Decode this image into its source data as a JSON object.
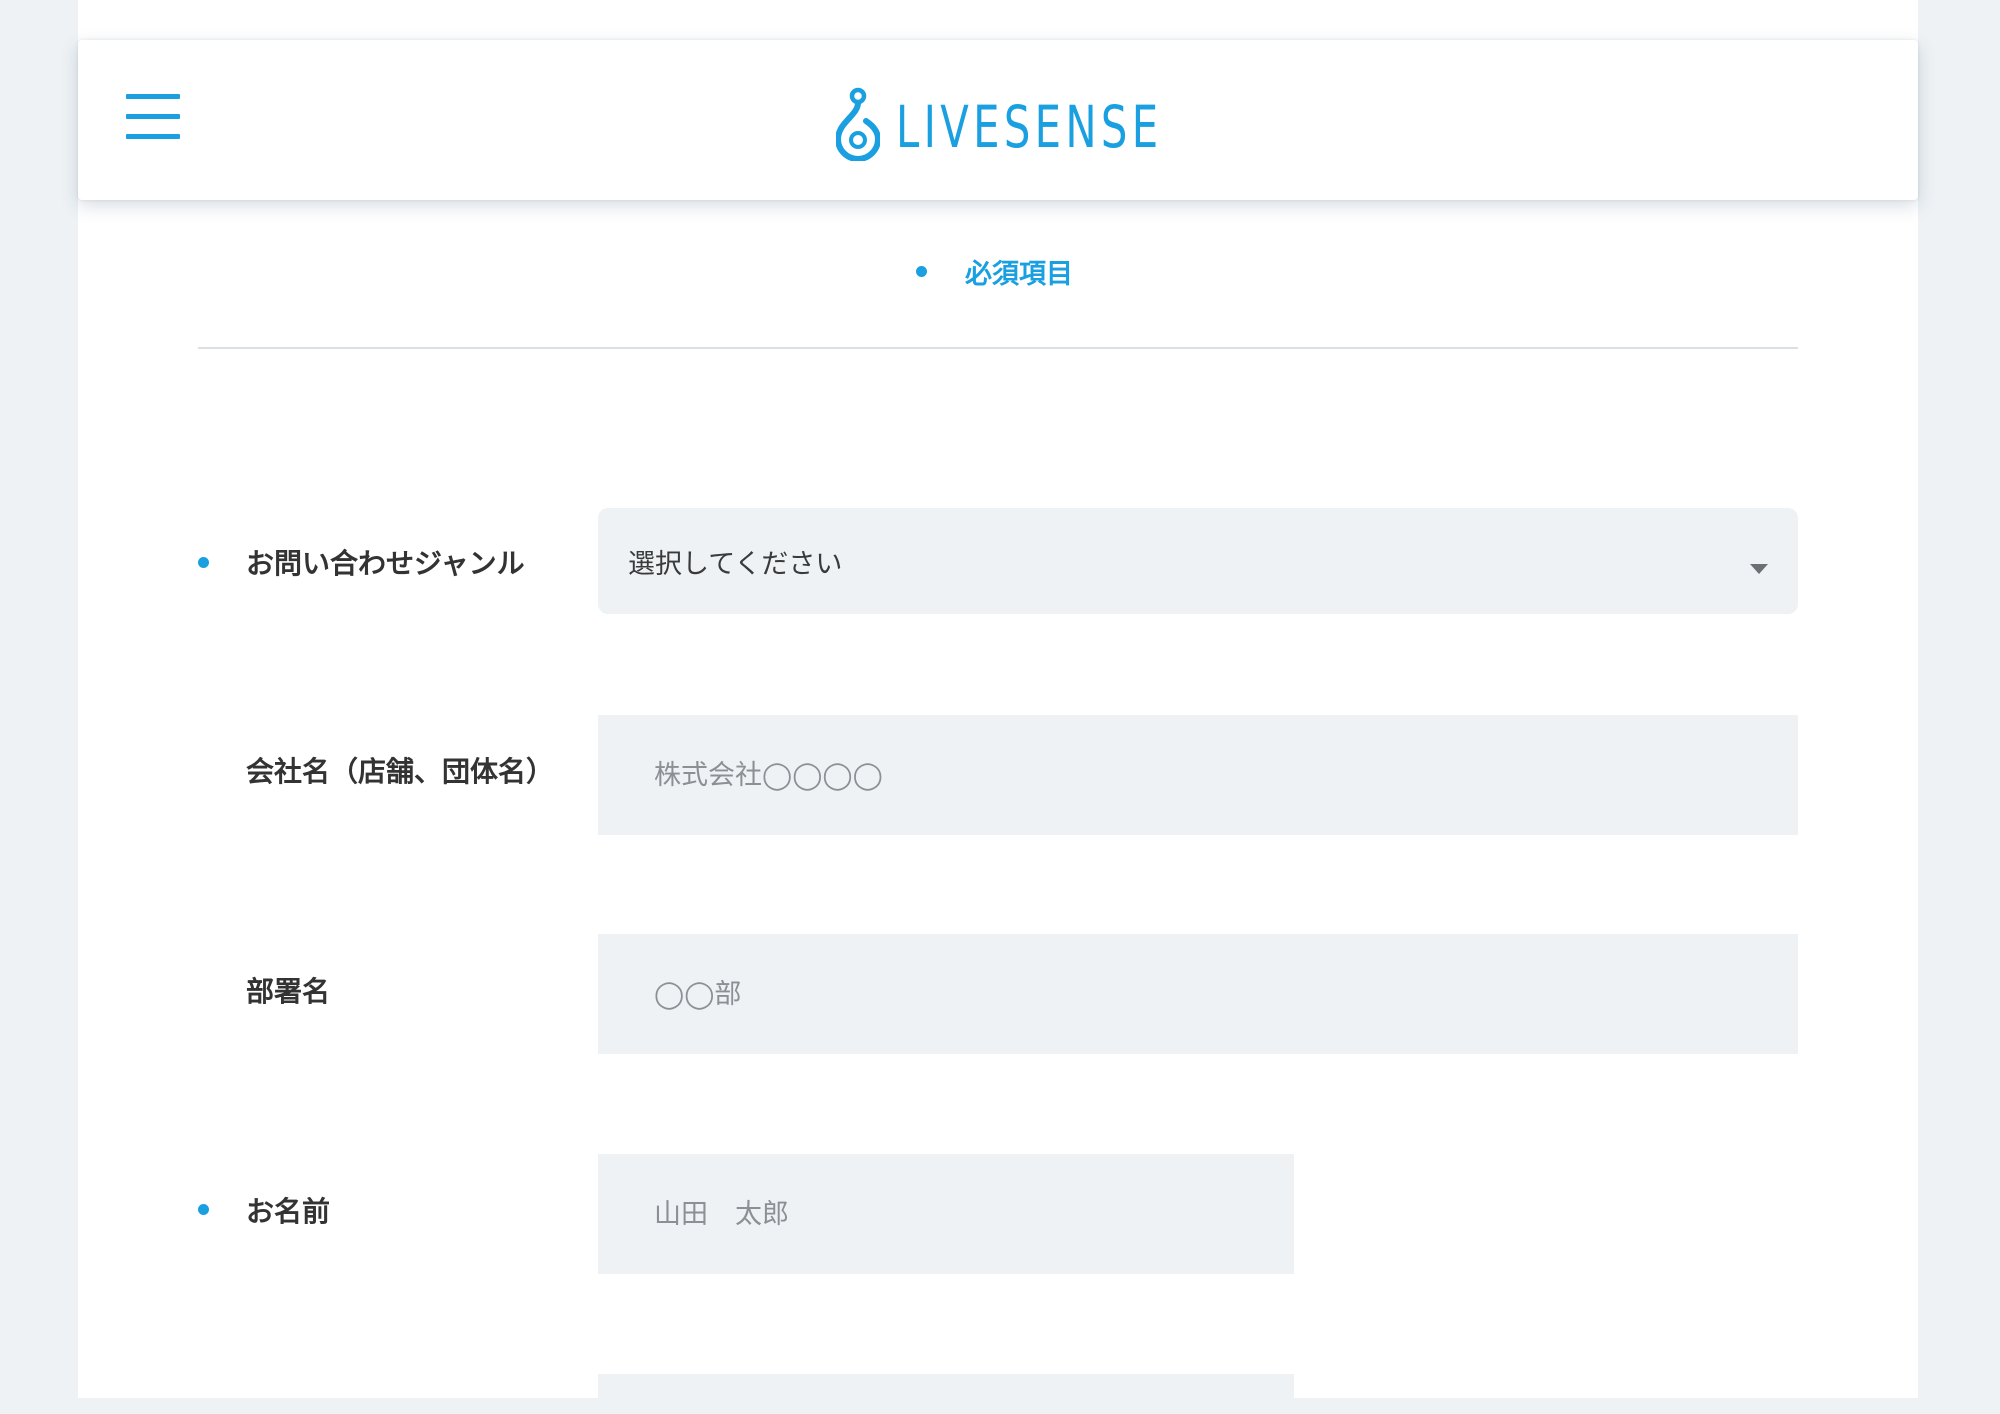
{
  "header": {
    "menu_icon": "hamburger-icon",
    "logo_text": "LIVESENSE",
    "logo_icon": "livesense-drop-icon",
    "brand_color": "#1aa0e0"
  },
  "legend": {
    "required_label": "必須項目"
  },
  "form": {
    "genre": {
      "label": "お問い合わせジャンル",
      "required": true,
      "selected": "選択してください"
    },
    "company": {
      "label": "会社名（店舗、団体名）",
      "required": false,
      "placeholder": "株式会社◯◯◯◯"
    },
    "department": {
      "label": "部署名",
      "required": false,
      "placeholder": "◯◯部"
    },
    "name": {
      "label": "お名前",
      "required": true,
      "placeholder": "山田　太郎"
    },
    "next_field": {
      "placeholder": ""
    }
  }
}
